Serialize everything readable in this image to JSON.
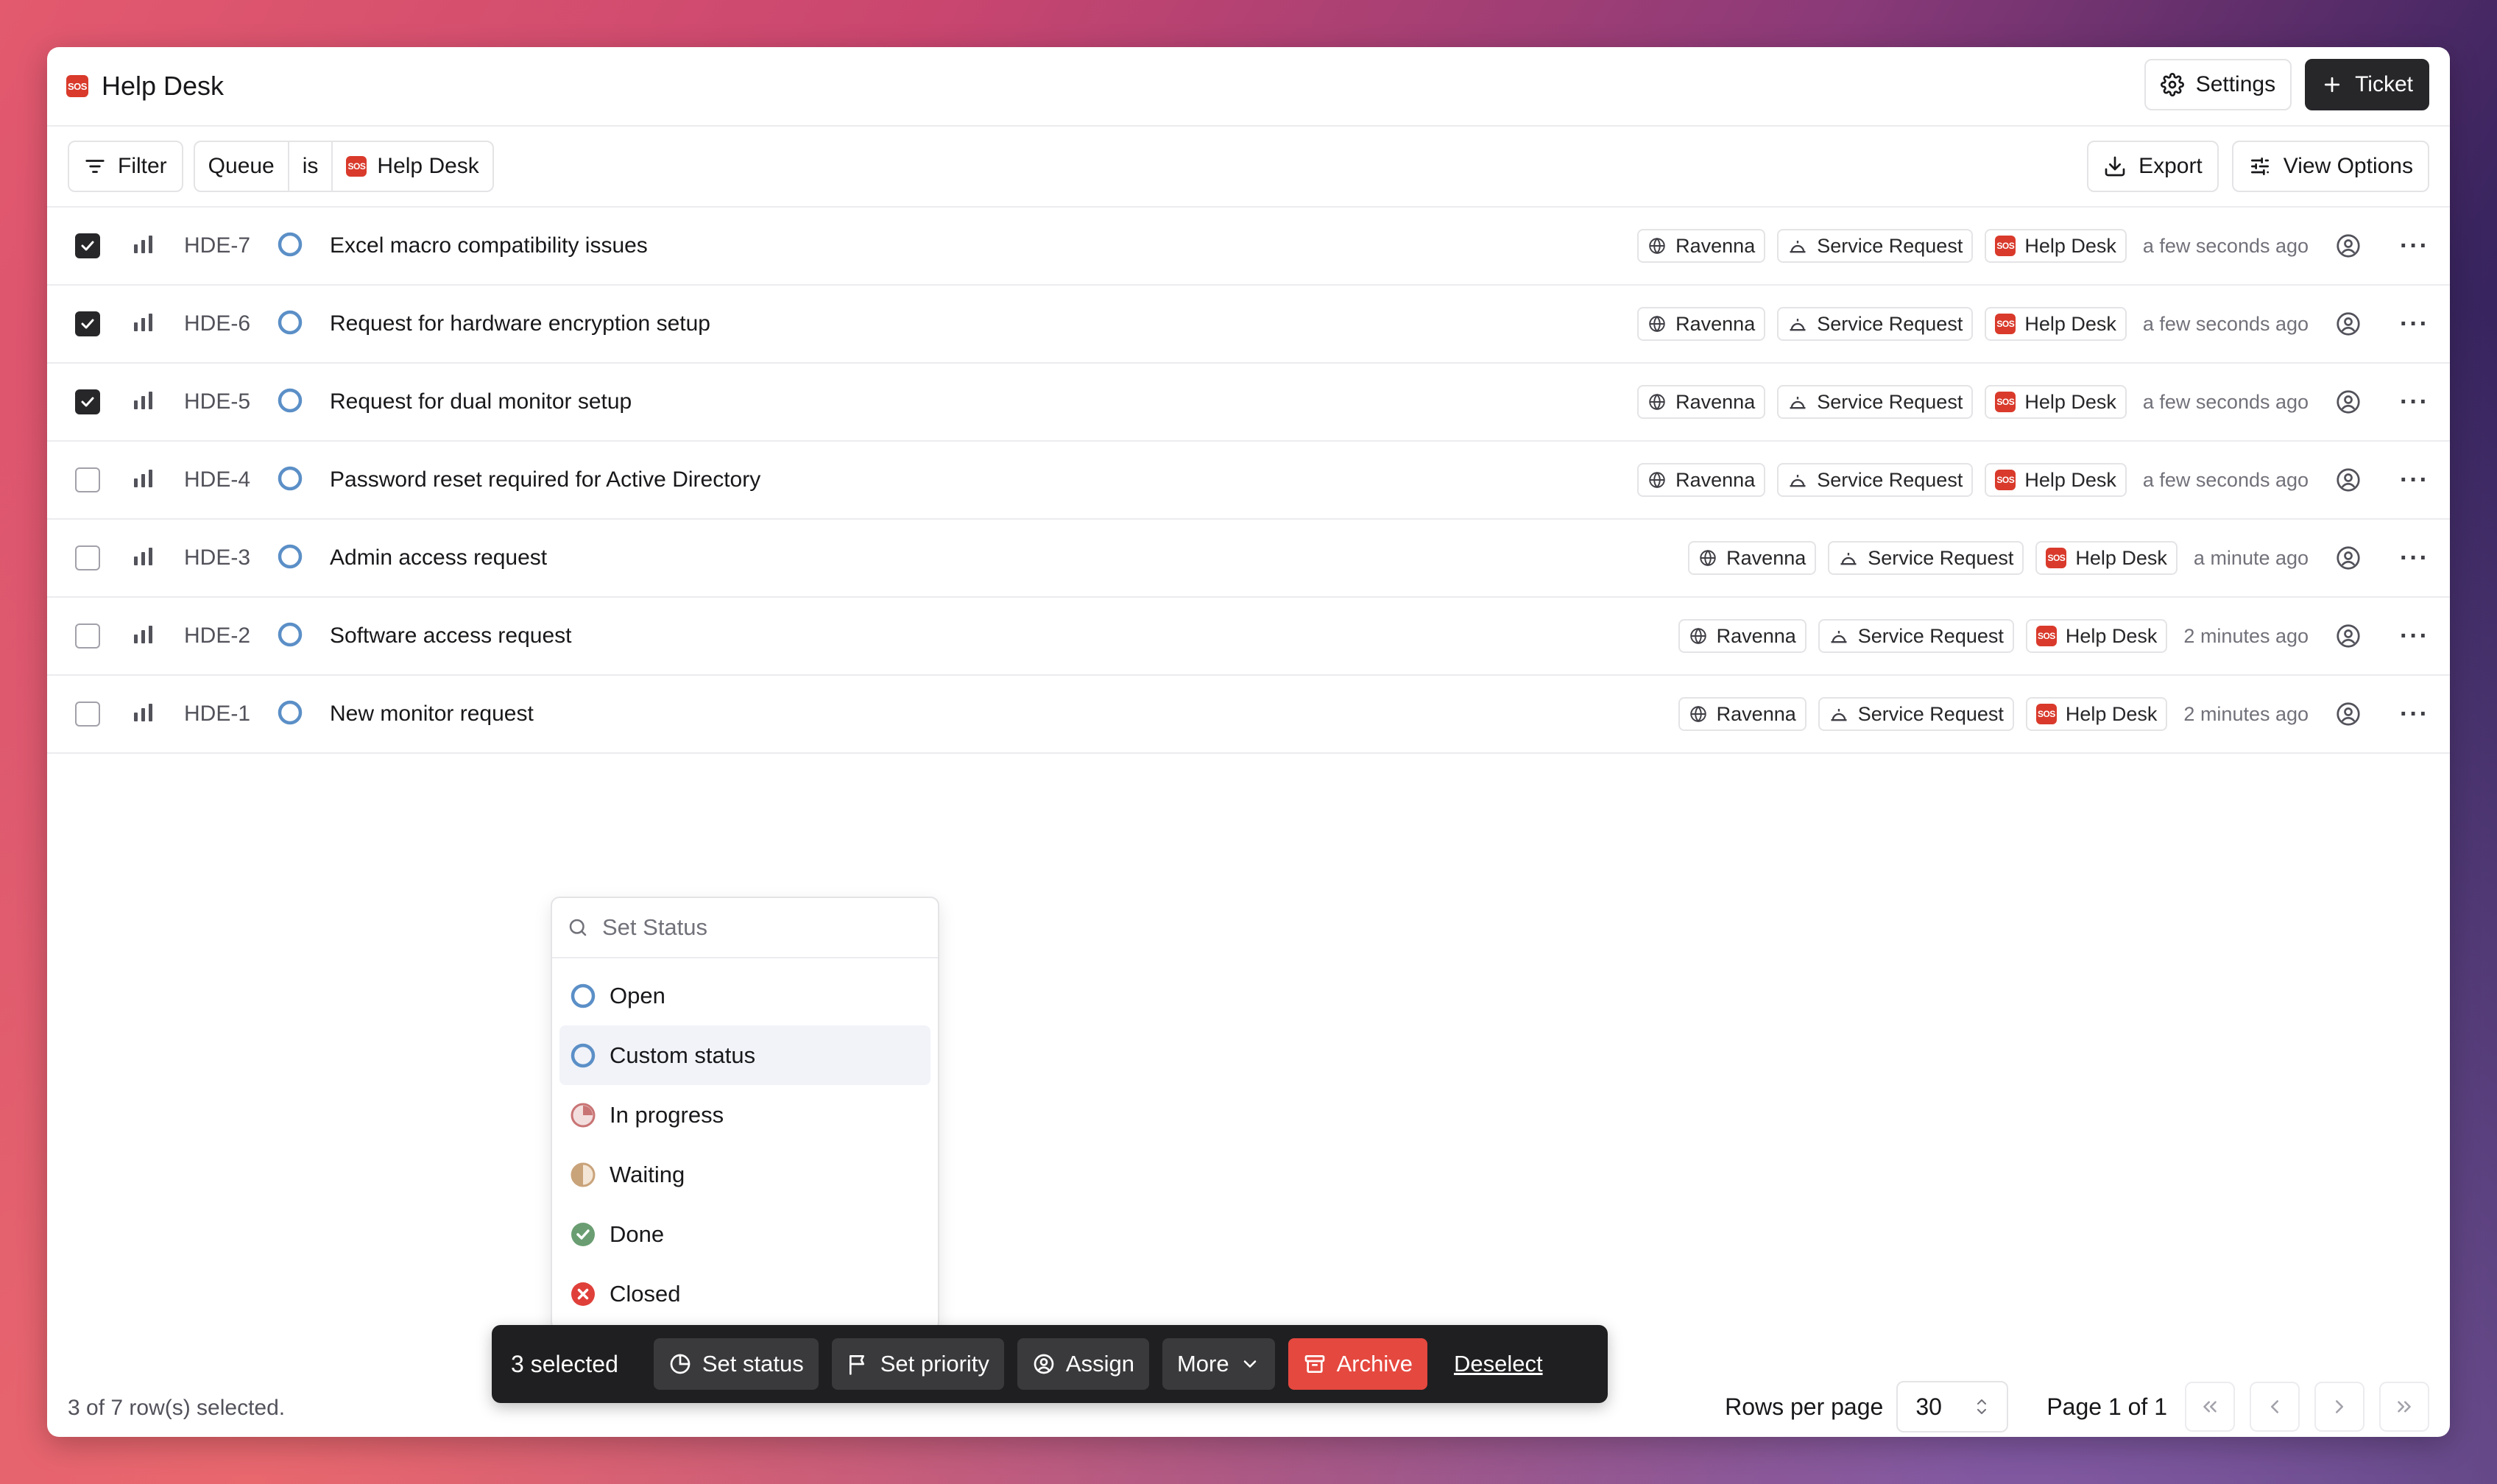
{
  "app": {
    "title": "Help Desk"
  },
  "header": {
    "settings_label": "Settings",
    "new_ticket_label": "Ticket"
  },
  "toolbar": {
    "filter_label": "Filter",
    "filter_chip": {
      "field": "Queue",
      "operator": "is",
      "value": "Help Desk"
    },
    "export_label": "Export",
    "view_options_label": "View Options"
  },
  "tickets": [
    {
      "id": "HDE-7",
      "title": "Excel macro compatibility issues",
      "selected": true,
      "org": "Ravenna",
      "type": "Service Request",
      "queue": "Help Desk",
      "time": "a few seconds ago"
    },
    {
      "id": "HDE-6",
      "title": "Request for hardware encryption setup",
      "selected": true,
      "org": "Ravenna",
      "type": "Service Request",
      "queue": "Help Desk",
      "time": "a few seconds ago"
    },
    {
      "id": "HDE-5",
      "title": "Request for dual monitor setup",
      "selected": true,
      "org": "Ravenna",
      "type": "Service Request",
      "queue": "Help Desk",
      "time": "a few seconds ago"
    },
    {
      "id": "HDE-4",
      "title": "Password reset required for Active Directory",
      "selected": false,
      "org": "Ravenna",
      "type": "Service Request",
      "queue": "Help Desk",
      "time": "a few seconds ago"
    },
    {
      "id": "HDE-3",
      "title": "Admin access request",
      "selected": false,
      "org": "Ravenna",
      "type": "Service Request",
      "queue": "Help Desk",
      "time": "a minute ago"
    },
    {
      "id": "HDE-2",
      "title": "Software access request",
      "selected": false,
      "org": "Ravenna",
      "type": "Service Request",
      "queue": "Help Desk",
      "time": "2 minutes ago"
    },
    {
      "id": "HDE-1",
      "title": "New monitor request",
      "selected": false,
      "org": "Ravenna",
      "type": "Service Request",
      "queue": "Help Desk",
      "time": "2 minutes ago"
    }
  ],
  "status_menu": {
    "placeholder": "Set Status",
    "options": [
      {
        "label": "Open",
        "icon": "circle-outline-blue"
      },
      {
        "label": "Custom status",
        "icon": "circle-outline-blue",
        "highlighted": true
      },
      {
        "label": "In progress",
        "icon": "pie-quarter-red"
      },
      {
        "label": "Waiting",
        "icon": "half-circle-tan"
      },
      {
        "label": "Done",
        "icon": "check-circle-green"
      },
      {
        "label": "Closed",
        "icon": "x-circle-red"
      }
    ]
  },
  "action_bar": {
    "count_label": "3 selected",
    "set_status_label": "Set status",
    "set_priority_label": "Set priority",
    "assign_label": "Assign",
    "more_label": "More",
    "archive_label": "Archive",
    "deselect_label": "Deselect"
  },
  "footer": {
    "selection_text": "3 of 7 row(s) selected.",
    "rows_per_page_label": "Rows per page",
    "rows_per_page_value": "30",
    "page_text": "Page 1 of 1"
  },
  "colors": {
    "status_open": "#5b8fc7",
    "archive_red": "#e5483f",
    "sos_red": "#d93a2b",
    "dark_button": "#27272a"
  }
}
